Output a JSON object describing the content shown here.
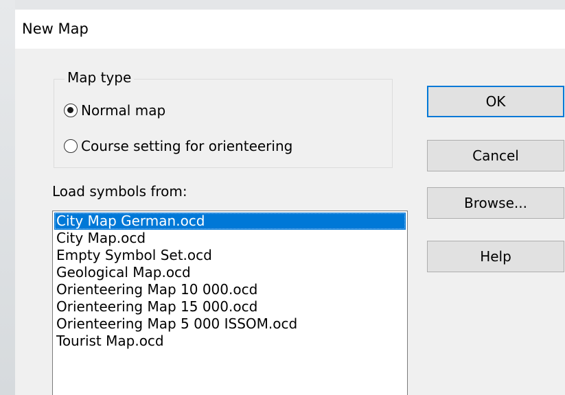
{
  "dialog": {
    "title": "New Map"
  },
  "map_type": {
    "group_label": "Map type",
    "options": [
      {
        "label": "Normal map",
        "checked": true
      },
      {
        "label": "Course setting for orienteering",
        "checked": false
      }
    ]
  },
  "symbols": {
    "label": "Load symbols from:",
    "items": [
      "City Map German.ocd",
      "City Map.ocd",
      "Empty Symbol Set.ocd",
      "Geological Map.ocd",
      "Orienteering Map 10 000.ocd",
      "Orienteering Map 15 000.ocd",
      "Orienteering Map 5 000 ISSOM.ocd",
      "Tourist Map.ocd"
    ],
    "selected": "City Map German.ocd"
  },
  "buttons": {
    "ok": "OK",
    "cancel": "Cancel",
    "browse": "Browse...",
    "help": "Help"
  },
  "colors": {
    "selection": "#0078d7",
    "default_button_border": "#0078d7",
    "dialog_background": "#f0f0f0"
  }
}
